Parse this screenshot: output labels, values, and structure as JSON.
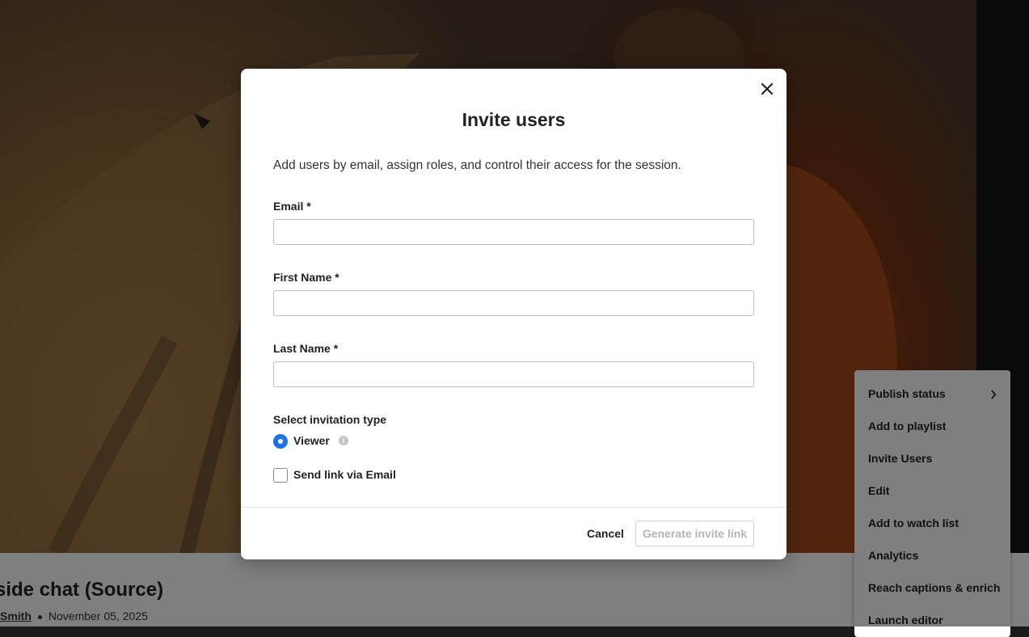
{
  "background": {
    "video_title": "side chat (Source)",
    "author": "Smith",
    "date": "November 05, 2025"
  },
  "context_menu": {
    "items": [
      {
        "label": "Publish status",
        "icon": "chevron-right-icon"
      },
      {
        "label": "Add to playlist"
      },
      {
        "label": "Invite Users"
      },
      {
        "label": "Edit"
      },
      {
        "label": "Add to watch list"
      },
      {
        "label": "Analytics"
      },
      {
        "label": "Reach captions & enrich"
      },
      {
        "label": "Launch editor"
      }
    ]
  },
  "modal": {
    "title": "Invite users",
    "description": "Add users by email, assign roles, and control their access for the session.",
    "fields": {
      "email": {
        "label": "Email *",
        "value": "",
        "placeholder": ""
      },
      "first_name": {
        "label": "First Name *",
        "value": "",
        "placeholder": ""
      },
      "last_name": {
        "label": "Last Name *",
        "value": "",
        "placeholder": ""
      }
    },
    "invitation_type_label": "Select invitation type",
    "invitation_option": "Viewer",
    "send_email_label": "Send link via Email",
    "cancel_label": "Cancel",
    "generate_label": "Generate invite link",
    "accent_color": "#1a73e8"
  }
}
